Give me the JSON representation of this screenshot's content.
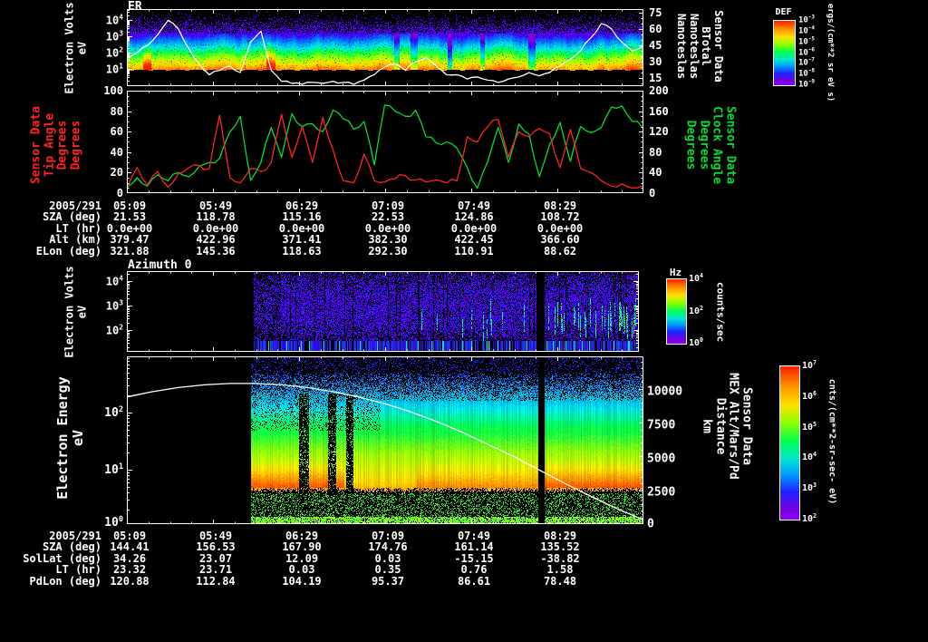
{
  "panel_er": {
    "title": "ER",
    "ylabel_lines": [
      "Electron Volts",
      "eV"
    ],
    "yticks": [
      {
        "t": "10^4",
        "y": 12
      },
      {
        "t": "10^3",
        "y": 30
      },
      {
        "t": "10^2",
        "y": 48
      },
      {
        "t": "10^1",
        "y": 66
      }
    ],
    "right_ticks": [
      {
        "t": "75",
        "y": 4
      },
      {
        "t": "60",
        "y": 22
      },
      {
        "t": "45",
        "y": 40
      },
      {
        "t": "30",
        "y": 58
      },
      {
        "t": "15",
        "y": 76
      }
    ],
    "right_label_lines": [
      "Sensor Data",
      "BTotal",
      "Nanoteslas",
      "Nanoteslas"
    ],
    "colorbar": {
      "title": "DEF",
      "unit": "ergs/(cm**2 sr eV s)",
      "ticks": [
        {
          "t": "10^-3",
          "y": 0
        },
        {
          "t": "10^-4",
          "y": 12
        },
        {
          "t": "10^-5",
          "y": 24
        },
        {
          "t": "10^-6",
          "y": 36
        },
        {
          "t": "10^-7",
          "y": 47
        },
        {
          "t": "10^-8",
          "y": 59
        },
        {
          "t": "10^-9",
          "y": 71
        }
      ]
    }
  },
  "panel_angles": {
    "left_ticks": [
      {
        "t": "100",
        "y": 0
      },
      {
        "t": "80",
        "y": 23
      },
      {
        "t": "60",
        "y": 45
      },
      {
        "t": "40",
        "y": 68
      },
      {
        "t": "20",
        "y": 90
      },
      {
        "t": "0",
        "y": 113
      }
    ],
    "left_label_lines": [
      "Sensor Data",
      "Tip Angle",
      "Degrees",
      "Degrees"
    ],
    "right_ticks": [
      {
        "t": "200",
        "y": 0
      },
      {
        "t": "160",
        "y": 23
      },
      {
        "t": "120",
        "y": 45
      },
      {
        "t": "80",
        "y": 68
      },
      {
        "t": "40",
        "y": 90
      },
      {
        "t": "0",
        "y": 113
      }
    ],
    "right_label_lines": [
      "Sensor Data",
      "Clock Angle",
      "Degrees",
      "Degrees"
    ],
    "red": "#ff2222",
    "green": "#00dd33"
  },
  "table1": {
    "row_labels": [
      "2005/291",
      "SZA (deg)",
      "LT (hr)",
      "Alt (km)",
      "ELon (deg)"
    ],
    "rows": [
      [
        "05:09",
        "05:49",
        "06:29",
        "07:09",
        "07:49",
        "08:29"
      ],
      [
        "21.53",
        "118.78",
        "115.16",
        "22.53",
        "124.86",
        "108.72"
      ],
      [
        "0.0e+00",
        "0.0e+00",
        "0.0e+00",
        "0.0e+00",
        "0.0e+00",
        "0.0e+00"
      ],
      [
        "379.47",
        "422.96",
        "371.41",
        "382.30",
        "422.45",
        "366.60"
      ],
      [
        "321.88",
        "145.36",
        "118.63",
        "292.30",
        "110.91",
        "88.62"
      ]
    ]
  },
  "panel_az": {
    "title": "Azimuth 0",
    "ylabel_lines": [
      "Electron Volts",
      "eV"
    ],
    "yticks": [
      {
        "t": "10^4",
        "y": 11
      },
      {
        "t": "10^3",
        "y": 38
      },
      {
        "t": "10^2",
        "y": 65
      }
    ],
    "colorbar": {
      "title": "Hz",
      "unit": "counts/sec",
      "ticks": [
        {
          "t": "10^4",
          "y": 0
        },
        {
          "t": "10^2",
          "y": 36
        },
        {
          "t": "10^0",
          "y": 71
        }
      ]
    }
  },
  "panel_energy": {
    "ylabel_lines": [
      "Electron Energy",
      "eV"
    ],
    "yticks": [
      {
        "t": "10^2",
        "y": 62
      },
      {
        "t": "10^1",
        "y": 125
      },
      {
        "t": "10^0",
        "y": 183
      }
    ],
    "right_ticks": [
      {
        "t": "10000",
        "y": 39
      },
      {
        "t": "7500",
        "y": 76
      },
      {
        "t": "5000",
        "y": 113
      },
      {
        "t": "2500",
        "y": 150
      },
      {
        "t": "0",
        "y": 185
      }
    ],
    "right_label_lines": [
      "Sensor Data",
      "MEX Alt/Mars/Pd",
      "Distance",
      "km"
    ],
    "colorbar": {
      "unit": "cnts/(cm**2-sr-sec- eV)",
      "ticks": [
        {
          "t": "10^7",
          "y": 0
        },
        {
          "t": "10^6",
          "y": 34
        },
        {
          "t": "10^5",
          "y": 68
        },
        {
          "t": "10^4",
          "y": 101
        },
        {
          "t": "10^3",
          "y": 135
        },
        {
          "t": "10^2",
          "y": 169
        }
      ]
    }
  },
  "table2": {
    "row_labels": [
      "2005/291",
      "SZA (deg)",
      "SolLat (deg)",
      "LT (hr)",
      "PdLon (deg)"
    ],
    "rows": [
      [
        "05:09",
        "05:49",
        "06:29",
        "07:09",
        "07:49",
        "08:29"
      ],
      [
        "144.41",
        "156.53",
        "167.90",
        "174.76",
        "161.14",
        "135.52"
      ],
      [
        "34.26",
        "23.07",
        "12.09",
        "0.03",
        "-15.15",
        "-38.82"
      ],
      [
        "23.32",
        "23.71",
        "0.03",
        "0.35",
        "0.76",
        "1.58"
      ],
      [
        "120.88",
        "112.84",
        "104.19",
        "95.37",
        "86.61",
        "78.48"
      ]
    ]
  },
  "chart_data": [
    {
      "id": "er",
      "type": "heatmap",
      "title": "ER",
      "x_ticklabels": [
        "05:09",
        "05:49",
        "06:29",
        "07:09",
        "07:49",
        "08:29"
      ],
      "ylabel": "Electron Volts eV",
      "yticks": [
        "10^4",
        "10^3",
        "10^2",
        "10^1"
      ],
      "colorbar": {
        "title": "DEF",
        "unit": "ergs/(cm**2 sr eV s)",
        "ticks": [
          "10^-3",
          "10^-4",
          "10^-5",
          "10^-6",
          "10^-7",
          "10^-8",
          "10^-9"
        ]
      },
      "desc": "electron differential energy flux spectrogram: sparse violet speckle above ~1 keV, continuous violet-blue-cyan-green-yellow-orange banding from ~300 eV down to ~10 eV, black below",
      "spike_cols": [
        [
          0.03,
          0.047
        ],
        [
          0.27,
          0.287
        ]
      ],
      "blue_streak_range": [
        0.5,
        0.78
      ],
      "overlay_line": {
        "name": "BTotal (nT)",
        "ylim": [
          15,
          75
        ],
        "axis_ticks": [
          75,
          60,
          45,
          30,
          15
        ],
        "y": [
          33,
          38,
          45,
          55,
          68,
          60,
          42,
          28,
          18,
          22,
          26,
          20,
          48,
          58,
          22,
          12,
          10,
          9,
          11,
          10,
          12,
          11,
          9,
          13,
          18,
          25,
          28,
          22,
          30,
          34,
          26,
          18,
          18,
          14,
          16,
          13,
          11,
          14,
          16,
          20,
          17,
          20,
          26,
          32,
          40,
          52,
          65,
          60,
          48,
          40,
          44
        ]
      }
    },
    {
      "id": "angles",
      "type": "line",
      "x_ticklabels": [
        "05:09",
        "05:49",
        "06:29",
        "07:09",
        "07:49",
        "08:29"
      ],
      "series": [
        {
          "name": "Tip Angle (deg)",
          "color": "#ff2222",
          "ylim": [
            0,
            100
          ],
          "yticks": [
            100,
            80,
            60,
            40,
            20,
            0
          ],
          "y": [
            4,
            25,
            8,
            21,
            6,
            19,
            25,
            27,
            24,
            76,
            15,
            10,
            24,
            21,
            30,
            77,
            35,
            65,
            30,
            74,
            42,
            12,
            10,
            38,
            12,
            11,
            14,
            17,
            13,
            11,
            13,
            10,
            12,
            55,
            50,
            65,
            72,
            35,
            60,
            55,
            63,
            58,
            25,
            62,
            24,
            20,
            12,
            7,
            9,
            5,
            7
          ]
        },
        {
          "name": "Clock Angle (deg)",
          "color": "#00dd33",
          "ylim": [
            0,
            200
          ],
          "yticks": [
            200,
            160,
            120,
            80,
            40,
            0
          ],
          "y": [
            12,
            30,
            14,
            36,
            24,
            40,
            32,
            52,
            60,
            68,
            120,
            150,
            25,
            60,
            128,
            70,
            155,
            130,
            135,
            120,
            162,
            145,
            125,
            140,
            55,
            172,
            160,
            150,
            162,
            110,
            98,
            100,
            88,
            50,
            10,
            62,
            128,
            60,
            135,
            115,
            32,
            95,
            138,
            62,
            130,
            118,
            128,
            168,
            170,
            140,
            128
          ]
        }
      ]
    },
    {
      "id": "azimuth",
      "type": "heatmap",
      "title": "Azimuth 0",
      "yticks": [
        "10^4",
        "10^3",
        "10^2"
      ],
      "colorbar": {
        "title": "Hz",
        "unit": "counts/sec",
        "ticks": [
          "10^4",
          "10^2",
          "10^0"
        ]
      },
      "data_start_frac": 0.246,
      "gap_frac": [
        0.8,
        0.815
      ],
      "desc": "count-rate spectrogram: black before ~05:58, then violet/blue noise speckle with cyan-green vertical bursts strengthening toward right; striped blue/violet base band at lowest energies"
    },
    {
      "id": "energy",
      "type": "heatmap",
      "yticks": [
        "10^2",
        "10^1",
        "10^0"
      ],
      "right_axis": {
        "label": "Distance km",
        "ticks": [
          10000,
          7500,
          5000,
          2500,
          0
        ]
      },
      "colorbar": {
        "unit": "cnts/(cm**2-sr-sec- eV)",
        "ticks": [
          "10^7",
          "10^6",
          "10^5",
          "10^4",
          "10^3",
          "10^2"
        ]
      },
      "data_start_frac": 0.24,
      "gap_frac": [
        0.795,
        0.808
      ],
      "partial_gaps": [
        [
          0.332,
          0.352
        ],
        [
          0.388,
          0.404
        ],
        [
          0.424,
          0.438
        ]
      ],
      "desc": "electron energy spectrogram: blue speckle above ~100 eV, cyan-green 20-80 eV, yellow-orange band 5-20 eV, speckled green floor at lowest energies",
      "overlay_line": {
        "name": "MEX Alt/Mars/Pd Distance (km)",
        "ylim": [
          0,
          12400
        ],
        "y": [
          9400,
          9800,
          10100,
          10300,
          10400,
          10400,
          10300,
          10100,
          9800,
          9400,
          8900,
          8300,
          7600,
          6800,
          5900,
          5000,
          4000,
          3000,
          2050,
          1150,
          350
        ]
      }
    }
  ]
}
